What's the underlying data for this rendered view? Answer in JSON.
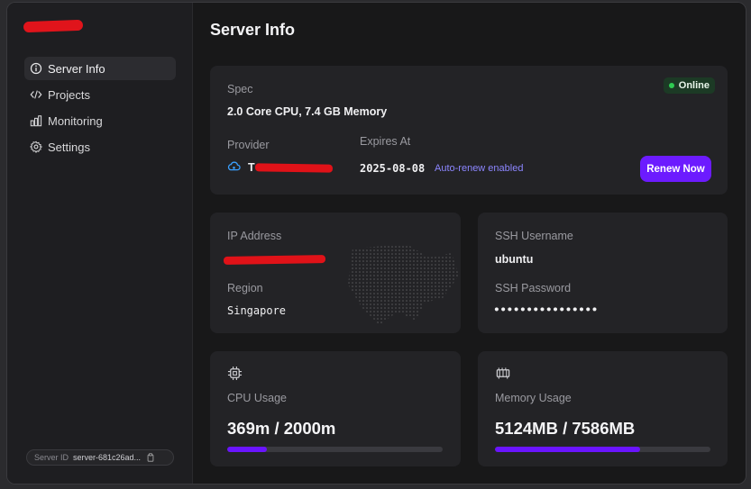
{
  "sidebar": {
    "items": [
      {
        "label": "Server Info",
        "icon": "info-icon"
      },
      {
        "label": "Projects",
        "icon": "code-icon"
      },
      {
        "label": "Monitoring",
        "icon": "bar-chart-icon"
      },
      {
        "label": "Settings",
        "icon": "gear-icon"
      }
    ],
    "server_id_label": "Server ID",
    "server_id_value": "server-681c26ad..."
  },
  "page": {
    "title": "Server Info"
  },
  "spec_card": {
    "spec_label": "Spec",
    "spec_value": "2.0 Core CPU, 7.4 GB Memory",
    "status": "Online",
    "provider_label": "Provider",
    "provider_value": "T",
    "expires_label": "Expires At",
    "expires_value": "2025-08-08",
    "auto_renew": "Auto-renew enabled",
    "renew_button": "Renew Now"
  },
  "network_card": {
    "ip_label": "IP Address",
    "region_label": "Region",
    "region_value": "Singapore"
  },
  "ssh_card": {
    "username_label": "SSH Username",
    "username_value": "ubuntu",
    "password_label": "SSH Password",
    "password_value": "●●●●●●●●●●●●●●●●"
  },
  "cpu_card": {
    "label": "CPU Usage",
    "value": "369m / 2000m",
    "used": 369,
    "total": 2000
  },
  "memory_card": {
    "label": "Memory Usage",
    "value": "5124MB / 7586MB",
    "used": 5124,
    "total": 7586
  },
  "colors": {
    "accent": "#6c1bff",
    "online": "#2ecc52",
    "auto_renew": "#8c86ff"
  }
}
